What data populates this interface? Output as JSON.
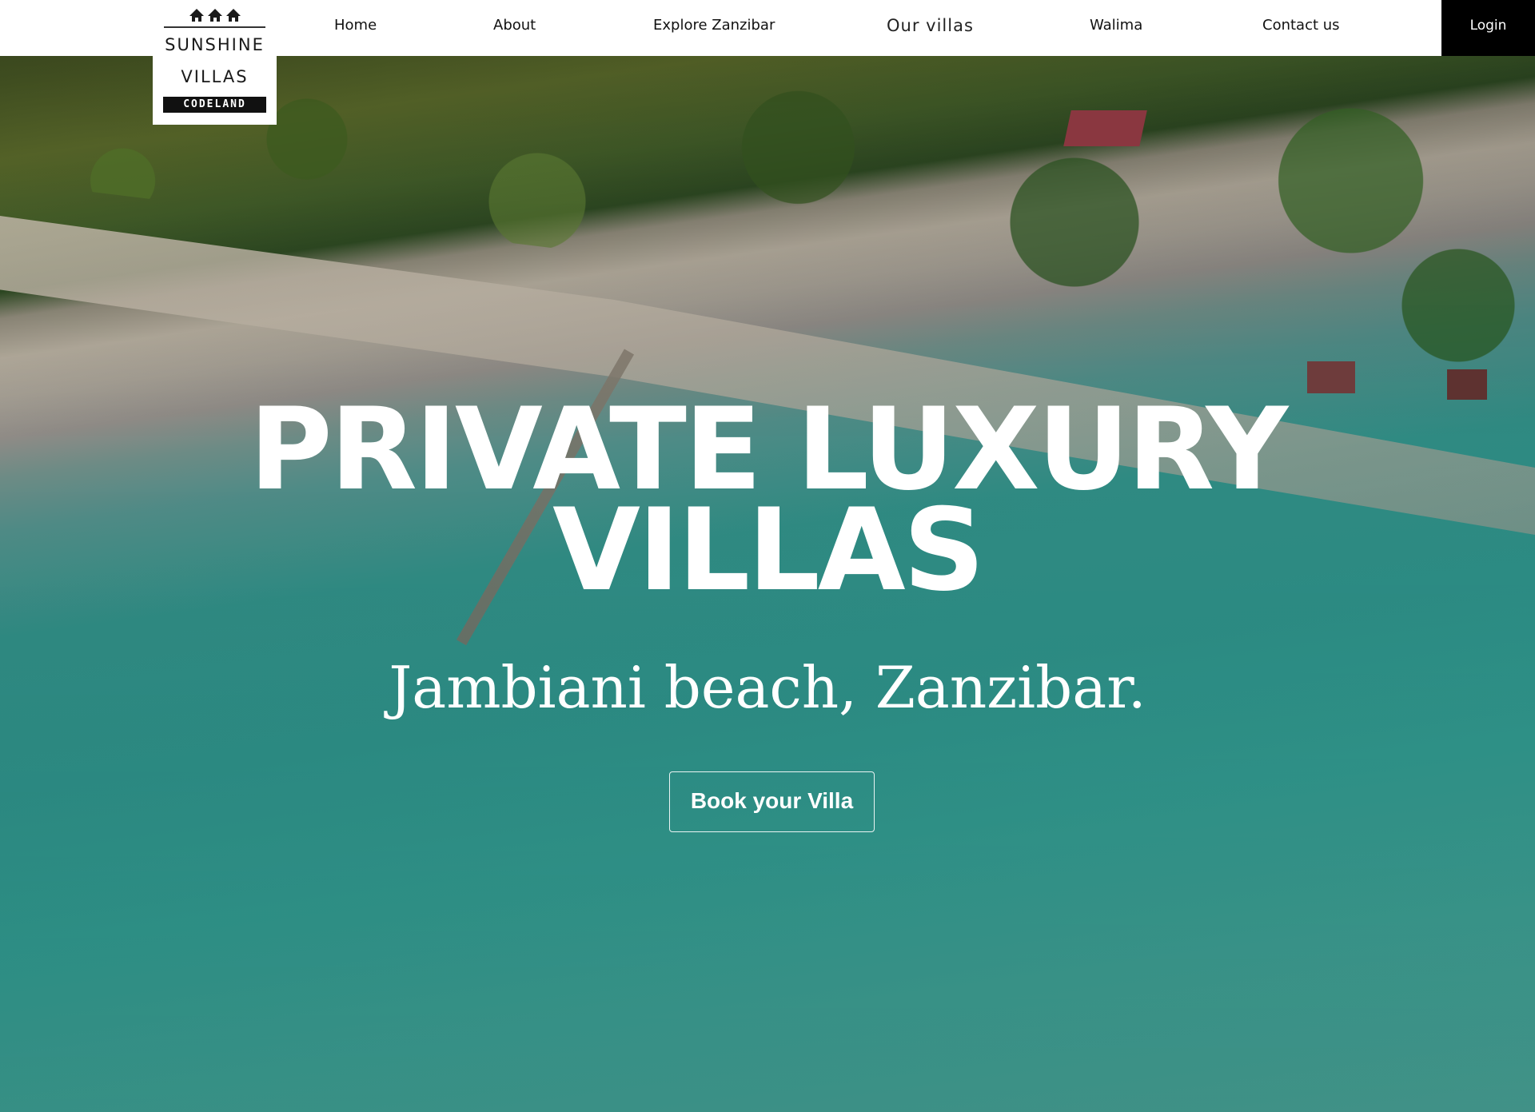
{
  "brand": {
    "name_line1": "SUNSHINE",
    "name_line2": "VILLAS",
    "tagline": "CODELAND",
    "icon": "villa-huts-icon"
  },
  "nav": {
    "items": [
      {
        "label": "Home"
      },
      {
        "label": "About"
      },
      {
        "label": "Explore Zanzibar"
      },
      {
        "label": "Our villas"
      },
      {
        "label": "Walima"
      },
      {
        "label": "Contact us"
      }
    ],
    "login_label": "Login"
  },
  "hero": {
    "title_line1": "PRIVATE LUXURY",
    "title_line2": "VILLAS",
    "subtitle": "Jambiani beach, Zanzibar.",
    "cta_label": "Book your Villa"
  },
  "colors": {
    "header_bg": "#ffffff",
    "login_bg": "#000000",
    "hero_text": "#ffffff",
    "water": "#2c8c84"
  }
}
